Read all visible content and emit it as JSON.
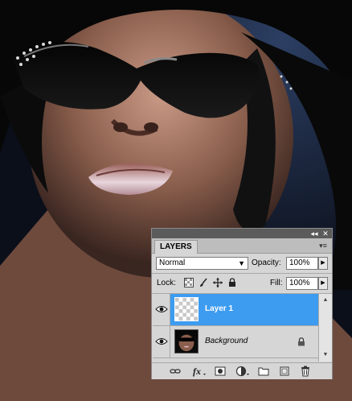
{
  "panel": {
    "tab_label": "LAYERS",
    "collapse_glyph": "◂◂",
    "close_glyph": "✕",
    "menu_glyph": "▾≡"
  },
  "blend_mode": {
    "selected": "Normal",
    "arrow": "▼"
  },
  "opacity": {
    "label": "Opacity:",
    "value": "100%",
    "arrow": "▶"
  },
  "lock": {
    "label": "Lock:"
  },
  "fill": {
    "label": "Fill:",
    "value": "100%",
    "arrow": "▶"
  },
  "layers": [
    {
      "name": "Layer 1",
      "selected": true,
      "visible": true,
      "locked": false
    },
    {
      "name": "Background",
      "selected": false,
      "visible": true,
      "locked": true
    }
  ],
  "scrollbar": {
    "up": "▲",
    "down": "▼"
  },
  "colors": {
    "selected_row": "#3d9cf0",
    "panel_bg": "#d6d6d6",
    "titlebar": "#5b5b5b"
  },
  "icons": {
    "bottom": [
      "link-icon",
      "fx-icon",
      "mask-icon",
      "adjustment-icon",
      "folder-icon",
      "new-layer-icon",
      "trash-icon"
    ],
    "lock": [
      "lock-transparent-icon",
      "lock-brush-icon",
      "lock-move-icon",
      "lock-all-icon"
    ]
  }
}
